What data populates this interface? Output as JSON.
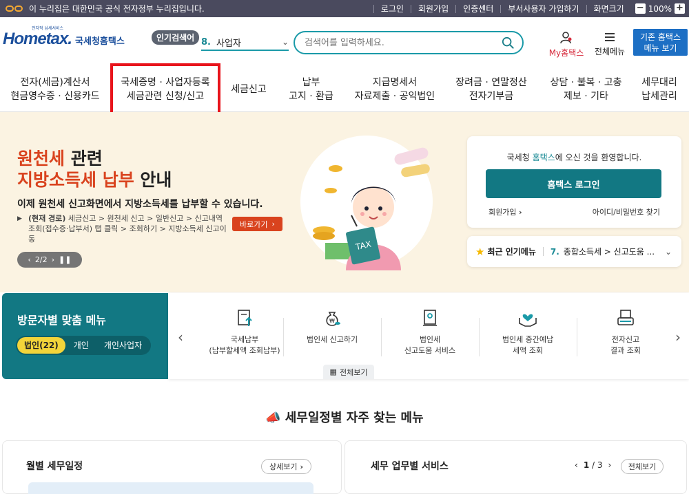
{
  "govbar": {
    "notice": "이 누리집은 대한민국 공식 전자정부 누리집입니다.",
    "links": [
      "로그인",
      "회원가입",
      "인증센터",
      "부서사용자 가입하기",
      "화면크기"
    ],
    "zoom_minus": "−",
    "zoom_value": "100%",
    "zoom_plus": "+"
  },
  "header": {
    "logo_small": "전자적 납세서비스",
    "logo_text": "Hometax.",
    "logo_kr": "국세청홈택스",
    "popular_tag": "인기검색어",
    "popular_num": "8.",
    "popular_value": "사업자",
    "search_placeholder": "검색어를 입력하세요.",
    "my_label": "My홈택스",
    "allmenu_label": "전체메뉴",
    "oldmenu_line1": "기존 홈택스",
    "oldmenu_line2": "메뉴 보기"
  },
  "gnb": [
    {
      "l1": "전자(세금)계산서",
      "l2": "현금영수증 · 신용카드"
    },
    {
      "l1": "국세증명 · 사업자등록",
      "l2": "세금관련 신청/신고"
    },
    {
      "l1": "세금신고",
      "l2": ""
    },
    {
      "l1": "납부",
      "l2": "고지 · 환급"
    },
    {
      "l1": "지급명세서",
      "l2": "자료제출 · 공익법인"
    },
    {
      "l1": "장려금 · 연말정산",
      "l2": "전자기부금"
    },
    {
      "l1": "상담 · 불복 · 고충",
      "l2": "제보 · 기타"
    },
    {
      "l1": "세무대리",
      "l2": "납세관리"
    }
  ],
  "hero": {
    "title_red1": "원천세",
    "title_black1": " 관련",
    "title_red2": "지방소득세 납부",
    "title_black2": " 안내",
    "desc": "이제 원천세 신고화면에서 지방소득세를 납부할 수 있습니다.",
    "path_bold": "(현재 경로)",
    "path_text": " 세금신고 > 원천세 신고 > 일반신고 > 신고내역 조회(접수증·납부서) 탭 클릭 > 조회하기 > 지방소득세 신고이동",
    "go_label": "바로가기",
    "pager_text": "2/2",
    "illus_text": "TAX"
  },
  "login": {
    "welcome_pre": "국세청 ",
    "welcome_hl": "홈택스",
    "welcome_post": "에 오신 것을 환영합니다.",
    "login_button": "홈택스 로그인",
    "join_label": "회원가입",
    "find_label": "아이디/비밀번호 찾기"
  },
  "popular_menu": {
    "label": "최근 인기메뉴",
    "num": "7.",
    "value": "종합소득세 > 신고도움 ..."
  },
  "visitor": {
    "title": "방문자별 맞춤 메뉴",
    "tabs": [
      "법인(22)",
      "개인",
      "개인사업자"
    ],
    "services": [
      {
        "l1": "국세납부",
        "l2": "(납부할세액 조회납부)"
      },
      {
        "l1": "법인세 신고하기",
        "l2": ""
      },
      {
        "l1": "법인세",
        "l2": "신고도움 서비스"
      },
      {
        "l1": "법인세 중간예납",
        "l2": "세액 조회"
      },
      {
        "l1": "전자신고",
        "l2": "결과 조회"
      }
    ],
    "viewall": "전체보기"
  },
  "section": {
    "title": "세무일정별 자주 찾는 메뉴",
    "monthly_title": "월별 세무일정",
    "monthly_btn": "상세보기",
    "service_title": "세무 업무별 서비스",
    "page_current": "1",
    "page_total": "/ 3",
    "service_btn": "전체보기"
  },
  "colors": {
    "teal": "#127883",
    "hero_bg": "#fbf3e2",
    "accent_red": "#d9431e",
    "highlight_box": "#e8141c",
    "brand_blue": "#1b4f9c"
  }
}
